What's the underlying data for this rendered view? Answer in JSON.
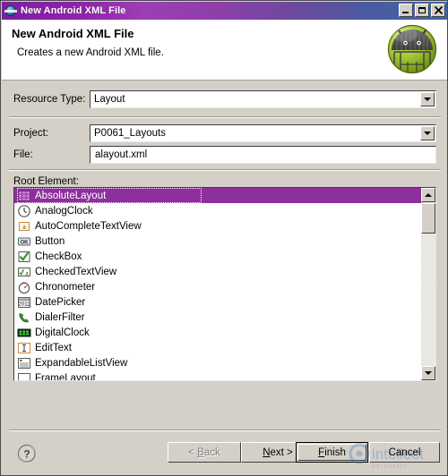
{
  "window": {
    "title": "New Android XML File",
    "title_icon": "android-globe-icon",
    "controls": [
      {
        "name": "minimize-button",
        "label": "_"
      },
      {
        "name": "maximize-button",
        "label": "□"
      },
      {
        "name": "close-button",
        "label": "✕"
      }
    ]
  },
  "header": {
    "title": "New Android XML File",
    "subtitle": "Creates a new Android XML file.",
    "logo": "android-robot-icon"
  },
  "form": {
    "resource_type": {
      "label": "Resource Type:",
      "value": "Layout"
    },
    "project": {
      "label": "Project:",
      "value": "P0061_Layouts"
    },
    "file": {
      "label": "File:",
      "value": "alayout.xml",
      "placeholder": ""
    },
    "root_element": {
      "label": "Root Element:"
    }
  },
  "root_element_list": {
    "selected_index": 0,
    "items": [
      {
        "label": "AbsoluteLayout",
        "icon": "absolute-layout-icon"
      },
      {
        "label": "AnalogClock",
        "icon": "analog-clock-icon"
      },
      {
        "label": "AutoCompleteTextView",
        "icon": "autocomplete-textview-icon"
      },
      {
        "label": "Button",
        "icon": "button-icon"
      },
      {
        "label": "CheckBox",
        "icon": "checkbox-icon"
      },
      {
        "label": "CheckedTextView",
        "icon": "checked-textview-icon"
      },
      {
        "label": "Chronometer",
        "icon": "chronometer-icon"
      },
      {
        "label": "DatePicker",
        "icon": "datepicker-icon"
      },
      {
        "label": "DialerFilter",
        "icon": "dialer-filter-icon"
      },
      {
        "label": "DigitalClock",
        "icon": "digital-clock-icon"
      },
      {
        "label": "EditText",
        "icon": "edittext-icon"
      },
      {
        "label": "ExpandableListView",
        "icon": "expandable-listview-icon"
      },
      {
        "label": "FrameLayout",
        "icon": "frame-layout-icon"
      }
    ],
    "scrollbar": {
      "up_arrow": "scroll-up-icon",
      "down_arrow": "scroll-down-icon"
    }
  },
  "footer": {
    "help": "help-icon",
    "buttons": [
      {
        "name": "back-button",
        "label": "< Back",
        "disabled": true,
        "default": false
      },
      {
        "name": "next-button",
        "label": "Next >",
        "disabled": false,
        "default": false
      },
      {
        "name": "finish-button",
        "label": "Finish",
        "disabled": false,
        "default": true
      },
      {
        "name": "cancel-button",
        "label": "Cancel",
        "disabled": false,
        "default": false
      }
    ]
  },
  "colors": {
    "selection": "#8e2f9e",
    "chrome": "#d4d0c8",
    "title_left": "#7b1fa2",
    "title_right": "#3a6aa8",
    "android_green": "#a4c639"
  }
}
